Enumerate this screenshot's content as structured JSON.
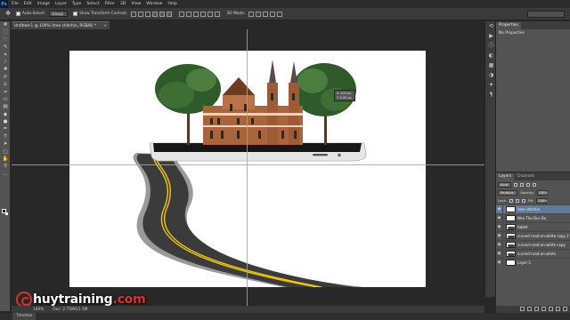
{
  "app": {
    "logo": "Ps"
  },
  "menu": [
    "File",
    "Edit",
    "Image",
    "Layer",
    "Type",
    "Select",
    "Filter",
    "3D",
    "View",
    "Window",
    "Help"
  ],
  "options_bar": {
    "tool_icon": "move-icon",
    "auto_select_label": "Auto-Select:",
    "auto_select_value": "Group",
    "transform_label": "Show Transform Controls",
    "mode_label": "3D Mode:"
  },
  "document_tab": {
    "title": "Untitled-1 @ 100% (tree chitchin, RGB/8) *",
    "close": "×"
  },
  "transform_tooltip": {
    "line1": "X: 424 px",
    "line2": "Y: 0.00 px"
  },
  "status": {
    "zoom": "100%",
    "doc": "Doc: 2.75M/21.5M"
  },
  "timeline": {
    "label": "Timeline"
  },
  "watermark": {
    "name": "huytraining",
    "tld": ".com"
  },
  "properties": {
    "tab": "Properties",
    "body": "No Properties"
  },
  "layers_panel": {
    "tabs": [
      "Layers",
      "Channels"
    ],
    "filter_label": "Kind",
    "blend_mode": "Multiply",
    "opacity_label": "Opacity:",
    "opacity_value": "100%",
    "lock_label": "Lock:",
    "fill_label": "Fill:",
    "fill_value": "100%",
    "layers": [
      {
        "name": "tree chitchin",
        "selected": true,
        "dark": false
      },
      {
        "name": "Nha Tho Duc Ba",
        "selected": false,
        "dark": false
      },
      {
        "name": "tablet",
        "selected": false,
        "dark": true
      },
      {
        "name": "curved-road-on-white copy 2",
        "selected": false,
        "dark": true
      },
      {
        "name": "curved-road-on-white copy",
        "selected": false,
        "dark": true
      },
      {
        "name": "curved-road-on-white",
        "selected": false,
        "dark": true
      },
      {
        "name": "Layer 5",
        "selected": false,
        "dark": false
      }
    ]
  },
  "colors": {
    "guide": "#45c8e6",
    "selected_layer": "#5e7aa0",
    "watermark_accent": "#d9342b",
    "road_line": "#f2c811"
  }
}
